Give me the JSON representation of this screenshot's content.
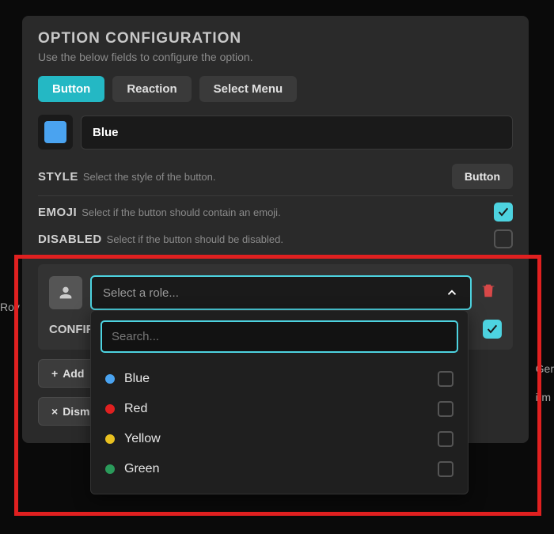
{
  "panel": {
    "title": "OPTION CONFIGURATION",
    "subtitle": "Use the below fields to configure the option."
  },
  "tabs": {
    "button": "Button",
    "reaction": "Reaction",
    "select_menu": "Select Menu"
  },
  "color": {
    "swatch_hex": "#4aa3f0",
    "name": "Blue"
  },
  "fields": {
    "style": {
      "label": "STYLE",
      "desc": "Select the style of the button.",
      "value": "Button"
    },
    "emoji": {
      "label": "EMOJI",
      "desc": "Select if the button should contain an emoji.",
      "checked": true
    },
    "disabled": {
      "label": "DISABLED",
      "desc": "Select if the button should be disabled.",
      "checked": false
    }
  },
  "role": {
    "select_placeholder": "Select a role...",
    "confirm_label": "CONFIR",
    "confirm_checked": true,
    "search_placeholder": "Search...",
    "add_label": "Add",
    "dismiss_label": "Dismi",
    "options": [
      {
        "label": "Blue",
        "color": "#4aa3f0"
      },
      {
        "label": "Red",
        "color": "#e02020"
      },
      {
        "label": "Yellow",
        "color": "#e8c020"
      },
      {
        "label": "Green",
        "color": "#2a9a5a"
      }
    ]
  },
  "bg": {
    "row": "Rov",
    "gen": "Ger",
    "irm": "irm"
  }
}
